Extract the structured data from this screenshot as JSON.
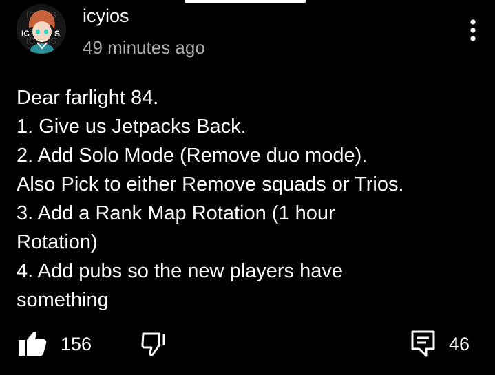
{
  "comment": {
    "author": "icyios",
    "timestamp": "49 minutes ago",
    "avatar_text": "ICYIOS",
    "lines": [
      "Dear farlight 84.",
      "1. Give us Jetpacks Back.",
      "2. Add Solo Mode (Remove duo mode).",
      "Also Pick to either Remove squads or Trios.",
      "3. Add a Rank Map Rotation (1 hour",
      "Rotation)",
      "4. Add pubs so the new players have",
      "something"
    ]
  },
  "actions": {
    "like_count": "156",
    "reply_count": "46",
    "like_icon": "thumbs-up-filled-icon",
    "dislike_icon": "thumbs-down-outline-icon",
    "reply_icon": "comment-reply-icon",
    "menu_icon": "more-vertical-icon"
  },
  "colors": {
    "background": "#000000",
    "text": "#ffffff",
    "muted_text": "#aaaaaa"
  }
}
